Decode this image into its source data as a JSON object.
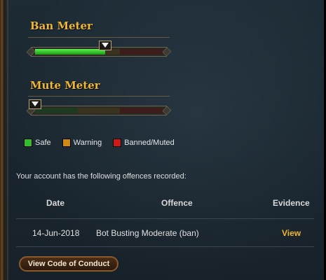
{
  "ban_meter": {
    "title": "Ban Meter",
    "level": 0.55
  },
  "mute_meter": {
    "title": "Mute Meter",
    "level": 0.0
  },
  "legend": [
    {
      "label": "Safe",
      "color": "#2fc02a"
    },
    {
      "label": "Warning",
      "color": "#d08a10"
    },
    {
      "label": "Banned/Muted",
      "color": "#d01a1a"
    }
  ],
  "offences": {
    "intro": "Your account has the following offences recorded:",
    "headers": {
      "date": "Date",
      "offence": "Offence",
      "evidence": "Evidence"
    },
    "rows": [
      {
        "date": "14-Jun-2018",
        "offence": "Bot Busting Moderate (ban)",
        "evidence": "View"
      }
    ]
  },
  "footer": {
    "coc_button": "View Code of Conduct"
  }
}
